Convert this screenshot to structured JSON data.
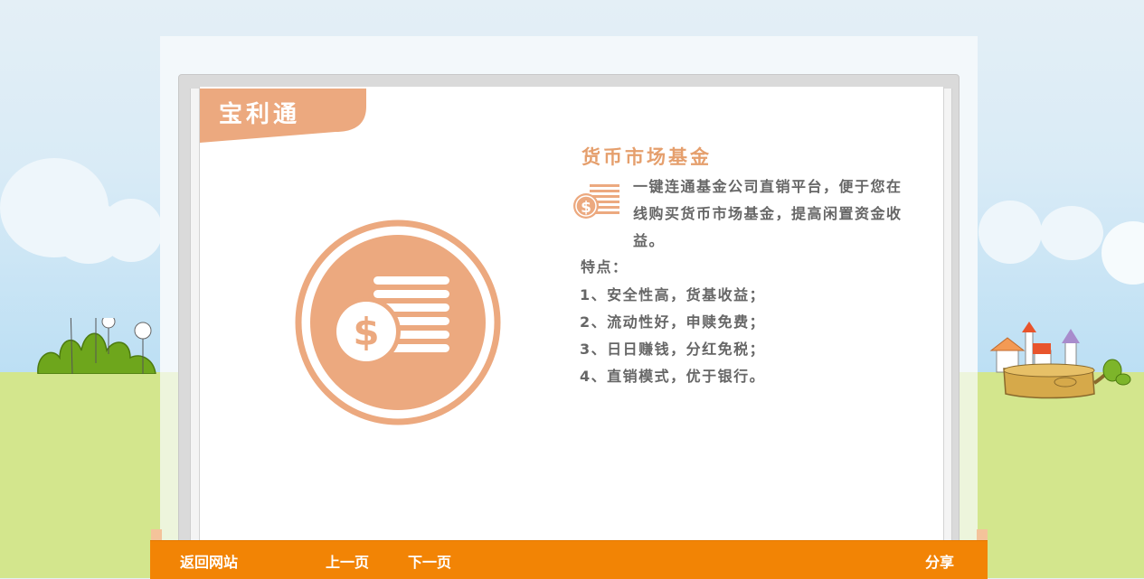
{
  "brand": {
    "name": "宝利通"
  },
  "content": {
    "title": "货币市场基金",
    "description": "一键连通基金公司直销平台，便于您在线购买货币市场基金，提高闲置资金收益。",
    "features_heading": "特点：",
    "features": [
      "1、安全性高，货基收益；",
      "2、流动性好，申赎免费；",
      "3、日日赚钱，分红免税；",
      "4、直销模式，优于银行。"
    ]
  },
  "nav": {
    "back_label": "返回网站",
    "prev_label": "上一页",
    "next_label": "下一页",
    "share_label": "分享"
  },
  "colors": {
    "accent": "#eca97f",
    "title": "#e59f6d",
    "bar": "#f28405",
    "text": "#666666"
  },
  "icons": {
    "hero": "dollar-coin-stack-icon",
    "description": "dollar-coin-stack-icon"
  }
}
